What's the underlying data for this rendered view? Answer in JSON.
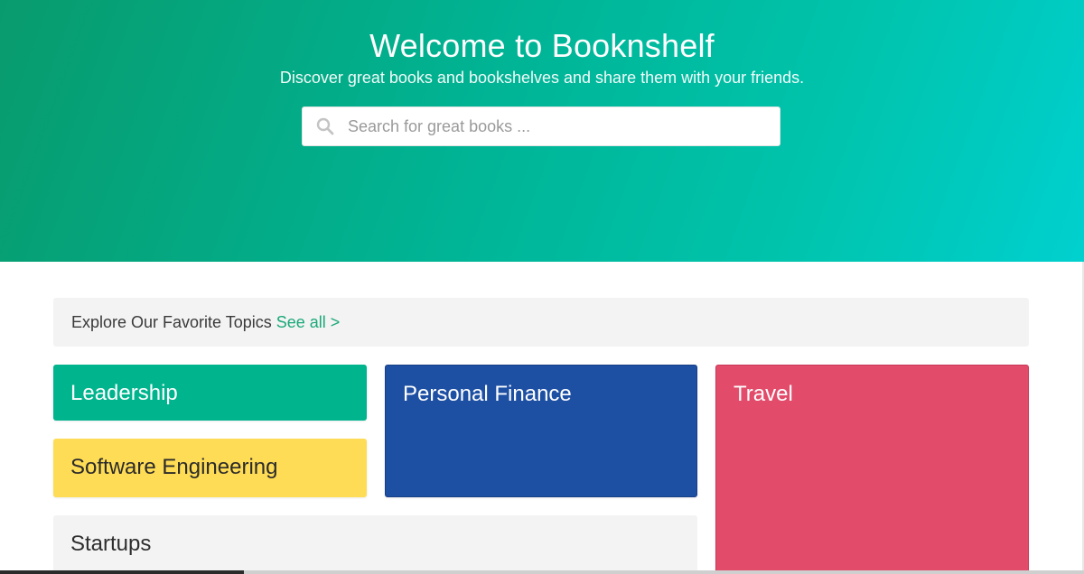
{
  "hero": {
    "title": "Welcome to Booknshelf",
    "subtitle": "Discover great books and bookshelves and share them with your friends.",
    "search": {
      "placeholder": "Search for great books ...",
      "icon": "search-icon"
    },
    "colors": {
      "gradient_start": "#089b6d",
      "gradient_end": "#00d0cf"
    }
  },
  "topics": {
    "heading": "Explore Our Favorite Topics",
    "see_all": "See all >",
    "see_all_color": "#1aa87a",
    "tiles": [
      {
        "label": "Leadership",
        "color": "#00b48e"
      },
      {
        "label": "Personal Finance",
        "color": "#1d4fa3"
      },
      {
        "label": "Travel",
        "color": "#e24b69"
      },
      {
        "label": "Software Engineering",
        "color": "#ffdc55"
      },
      {
        "label": "Startups",
        "color": "#f3f3f3"
      }
    ]
  }
}
